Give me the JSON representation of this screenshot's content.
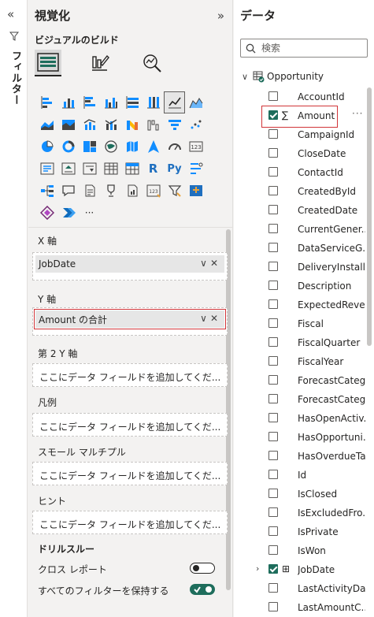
{
  "filter_strip": {
    "label": "フィルター"
  },
  "viz_panel": {
    "title": "視覚化",
    "subtitle": "ビジュアルのビルド",
    "more_label": "···"
  },
  "wells": {
    "x_axis": {
      "label": "X 軸",
      "field": "JobDate"
    },
    "y_axis": {
      "label": "Y 軸",
      "field": "Amount の合計"
    },
    "secondary_y": {
      "label": "第 2 Y 軸",
      "placeholder": "ここにデータ フィールドを追加してくだ..."
    },
    "legend": {
      "label": "凡例",
      "placeholder": "ここにデータ フィールドを追加してくだ..."
    },
    "small_multiples": {
      "label": "スモール マルチプル",
      "placeholder": "ここにデータ フィールドを追加してくだ..."
    },
    "tooltip": {
      "label": "ヒント",
      "placeholder": "ここにデータ フィールドを追加してくだ..."
    }
  },
  "drillthrough": {
    "title": "ドリルスルー",
    "cross_report": {
      "label": "クロス レポート",
      "on": false
    },
    "keep_filters": {
      "label": "すべてのフィルターを保持する",
      "on": true
    }
  },
  "data_panel": {
    "title": "データ",
    "search_placeholder": "検索",
    "table_name": "Opportunity",
    "fields": [
      {
        "name": "AccountId",
        "checked": false
      },
      {
        "name": "Amount",
        "checked": true,
        "icon": "∑",
        "selected": true
      },
      {
        "name": "CampaignId",
        "checked": false
      },
      {
        "name": "CloseDate",
        "checked": false
      },
      {
        "name": "ContactId",
        "checked": false
      },
      {
        "name": "CreatedById",
        "checked": false
      },
      {
        "name": "CreatedDate",
        "checked": false
      },
      {
        "name": "CurrentGener...",
        "checked": false
      },
      {
        "name": "DataServiceG...",
        "checked": false
      },
      {
        "name": "DeliveryInstall...",
        "checked": false
      },
      {
        "name": "Description",
        "checked": false
      },
      {
        "name": "ExpectedReve...",
        "checked": false
      },
      {
        "name": "Fiscal",
        "checked": false
      },
      {
        "name": "FiscalQuarter",
        "checked": false
      },
      {
        "name": "FiscalYear",
        "checked": false
      },
      {
        "name": "ForecastCateg...",
        "checked": false
      },
      {
        "name": "ForecastCateg...",
        "checked": false
      },
      {
        "name": "HasOpenActiv...",
        "checked": false
      },
      {
        "name": "HasOpportuni...",
        "checked": false
      },
      {
        "name": "HasOverdueTa...",
        "checked": false
      },
      {
        "name": "Id",
        "checked": false
      },
      {
        "name": "IsClosed",
        "checked": false
      },
      {
        "name": "IsExcludedFro...",
        "checked": false
      },
      {
        "name": "IsPrivate",
        "checked": false
      },
      {
        "name": "IsWon",
        "checked": false
      },
      {
        "name": "JobDate",
        "checked": true,
        "icon": "⊞",
        "expandable": true
      },
      {
        "name": "LastActivityDate",
        "checked": false
      },
      {
        "name": "LastAmountC...",
        "checked": false
      }
    ]
  },
  "colors": {
    "accent": "#1e6d5c",
    "highlight": "#d13438",
    "panel_bg": "#f3f2f1"
  }
}
